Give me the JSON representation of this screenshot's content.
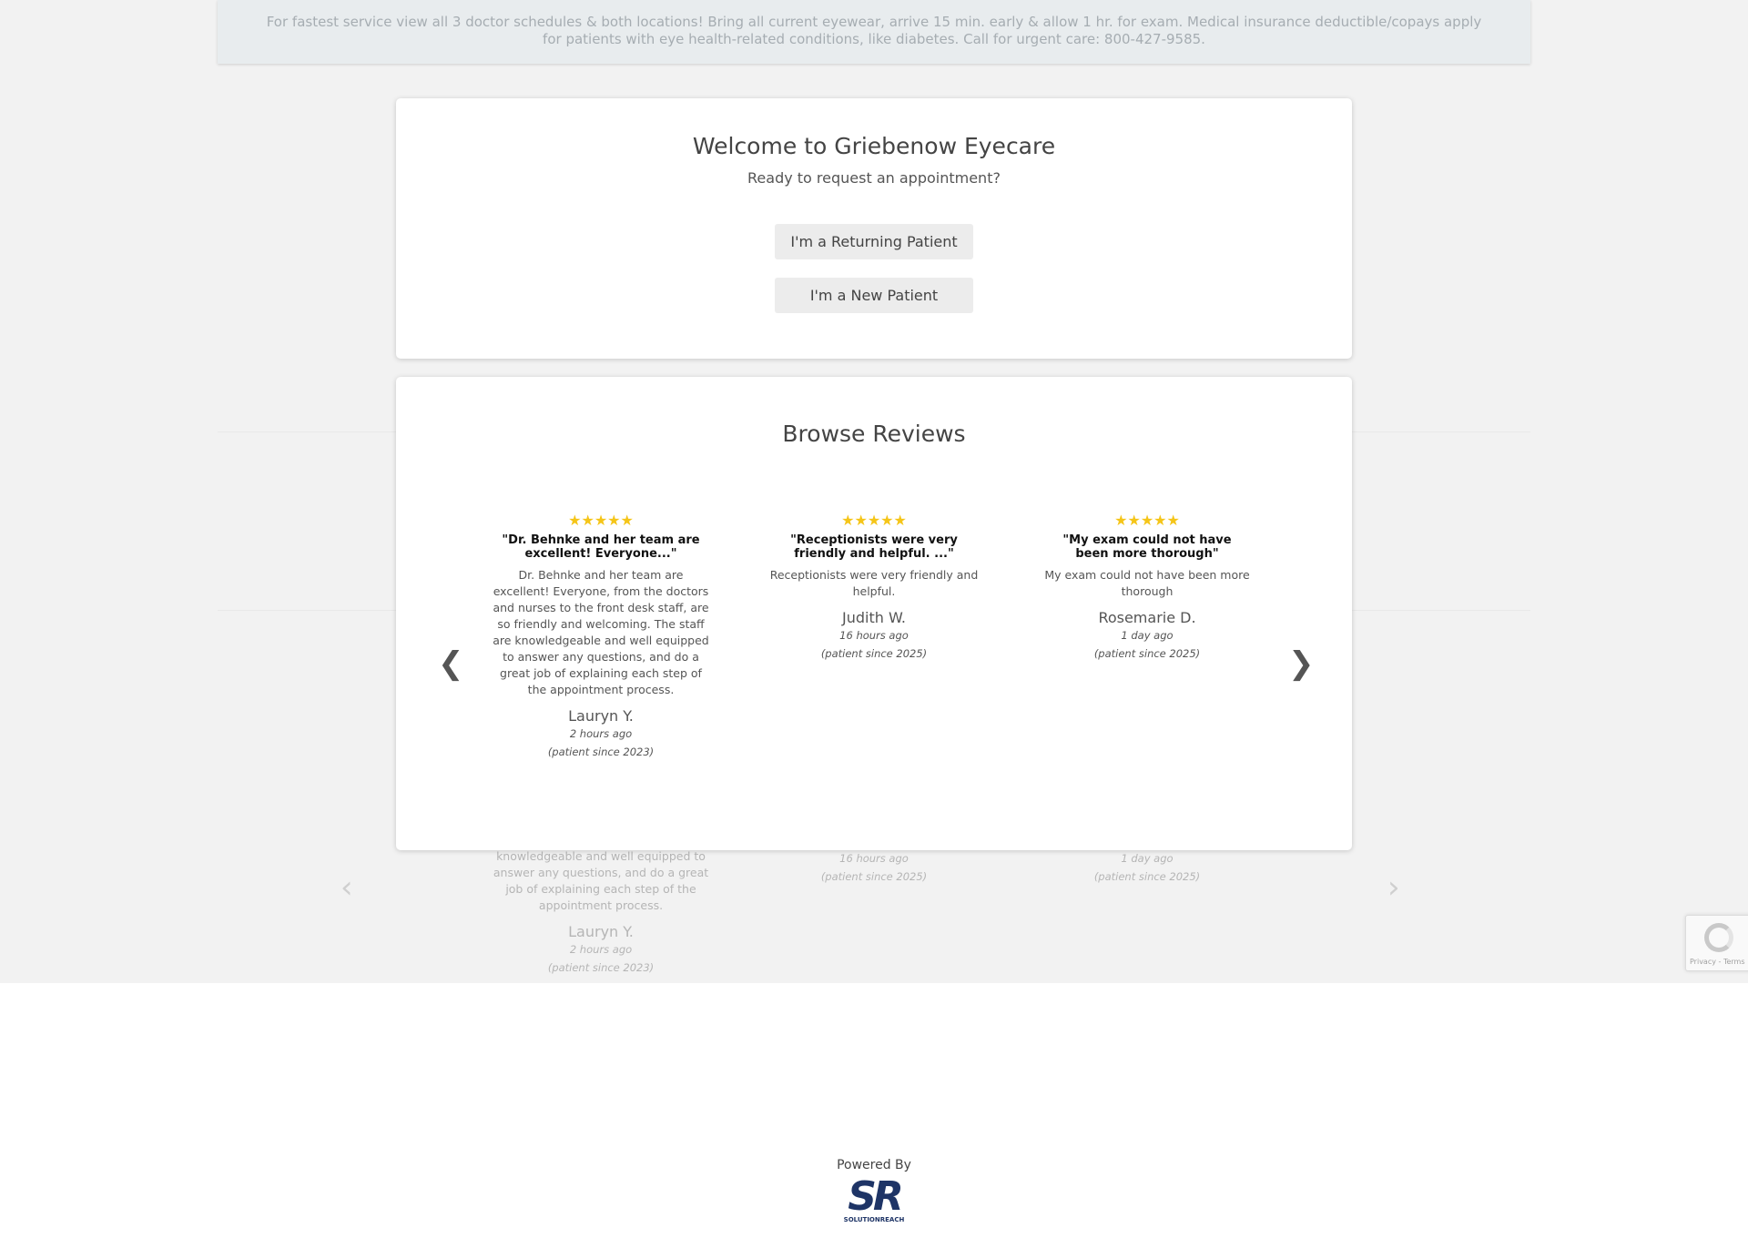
{
  "notice": {
    "text": "For fastest service view all 3 doctor schedules & both locations! Bring all current eyewear, arrive 15 min. early & allow 1 hr. for exam. Medical insurance deductible/copays apply for patients with eye health-related conditions, like diabetes. Call for urgent care: 800-427-9585."
  },
  "welcome": {
    "title": "Welcome to Griebenow Eyecare",
    "subtitle": "Ready to request an appointment?",
    "returning_button": "I'm a Returning Patient",
    "new_button": "I'm a New Patient"
  },
  "reviews": {
    "title": "Browse Reviews",
    "stars_glyph": "★★★★★",
    "prev_icon": "chevron-left-icon",
    "next_icon": "chevron-right-icon",
    "star_color": "#f5c518",
    "items": [
      {
        "rating": 5,
        "title": "\"Dr. Behnke and her team are excellent! Everyone...\"",
        "body": "Dr. Behnke and her team are excellent! Everyone, from the doctors and nurses to the front desk staff, are so friendly and welcoming. The staff are knowledgeable and well equipped to answer any questions, and do a great job of explaining each step of the appointment process.",
        "author": "Lauryn Y.",
        "time": "2 hours ago",
        "since": "(patient since 2023)"
      },
      {
        "rating": 5,
        "title": "\"Receptionists were very friendly and helpful. ...\"",
        "body": "Receptionists were very friendly and helpful.",
        "author": "Judith W.",
        "time": "16 hours ago",
        "since": "(patient since 2025)"
      },
      {
        "rating": 5,
        "title": "\"My exam could not have been more thorough\"",
        "body": "My exam could not have been more thorough",
        "author": "Rosemarie D.",
        "time": "1 day ago",
        "since": "(patient since 2025)"
      }
    ]
  },
  "ghost": {
    "col1_body": "knowledgeable and well equipped to answer any questions, and do a great job of explaining each step of the appointment process.",
    "col1_author": "Lauryn Y.",
    "col1_time": "2 hours ago",
    "col1_since": "(patient since 2023)",
    "col2_time": "16 hours ago",
    "col2_since": "(patient since 2025)",
    "col3_time": "1 day ago",
    "col3_since": "(patient since 2025)"
  },
  "recaptcha": {
    "terms": "Privacy - Terms"
  },
  "footer": {
    "powered_by": "Powered By",
    "logo_letters": "SR",
    "logo_name": "SOLUTIONREACH"
  }
}
